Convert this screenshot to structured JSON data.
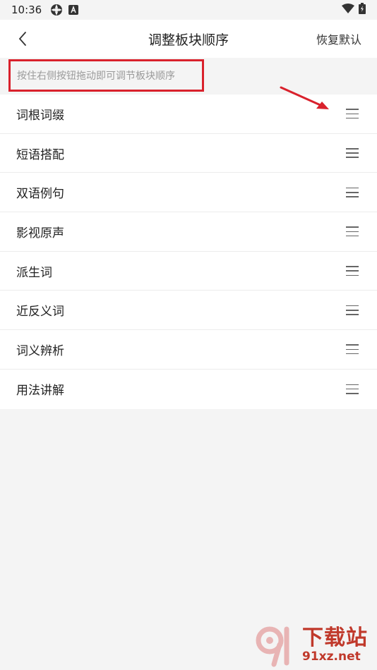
{
  "status_bar": {
    "time": "10:36",
    "icons": [
      "settings-app-icon",
      "a-badge-icon"
    ],
    "right_icons": [
      "wifi-icon",
      "battery-icon"
    ]
  },
  "toolbar": {
    "back_icon": "chevron-left-icon",
    "title": "调整板块顺序",
    "restore_label": "恢复默认"
  },
  "hint": {
    "text": "按住右侧按钮拖动即可调节板块顺序",
    "highlight_color": "#d9212c"
  },
  "sections": {
    "items": [
      {
        "label": "词根词缀"
      },
      {
        "label": "短语搭配"
      },
      {
        "label": "双语例句"
      },
      {
        "label": "影视原声"
      },
      {
        "label": "派生词"
      },
      {
        "label": "近反义词"
      },
      {
        "label": "词义辨析"
      },
      {
        "label": "用法讲解"
      }
    ],
    "handle_icon": "drag-handle-icon"
  },
  "annotation": {
    "arrow_color": "#d9212c"
  },
  "watermark": {
    "brand": "下载站",
    "url": "91xz.net",
    "color": "#c0392b"
  }
}
